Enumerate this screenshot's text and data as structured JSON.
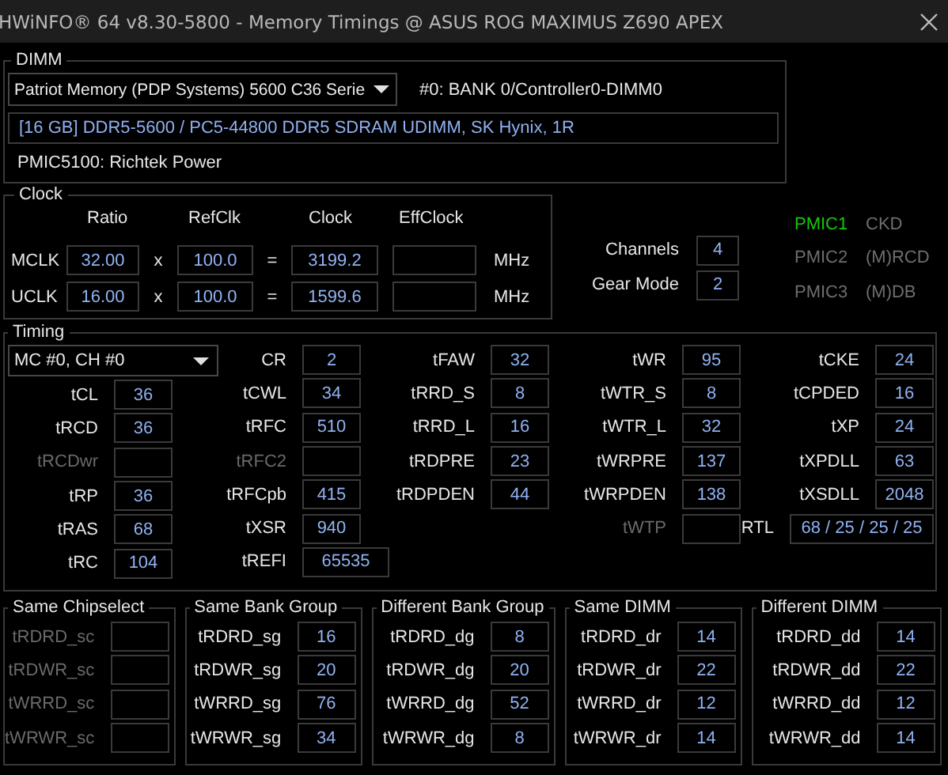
{
  "window": {
    "title": "HWiNFO® 64 v8.30-5800 - Memory Timings @ ASUS ROG MAXIMUS Z690 APEX"
  },
  "dimm": {
    "title": "DIMM",
    "module": {
      "value": "Patriot Memory (PDP Systems) 5600 C36 Serie"
    },
    "slot": "#0: BANK 0/Controller0-DIMM0",
    "description": "[16 GB] DDR5-5600 / PC5-44800 DDR5 SDRAM UDIMM, SK Hynix, 1R",
    "pmic": "PMIC5100: Richtek Power"
  },
  "clock": {
    "title": "Clock",
    "columns": [
      "Ratio",
      "RefClk",
      "Clock",
      "EffClock"
    ],
    "rows": [
      {
        "label": "MCLK",
        "ratio": "32.00",
        "times": "x",
        "refclk": "100.0",
        "equals": "=",
        "clock": "3199.2",
        "unit": "MHz"
      },
      {
        "label": "UCLK",
        "ratio": "16.00",
        "times": "x",
        "refclk": "100.0",
        "equals": "=",
        "clock": "1599.6",
        "unit": "MHz"
      }
    ]
  },
  "memory": [
    {
      "label": "Channels",
      "value": "4"
    },
    {
      "label": "Gear Mode",
      "value": "2"
    }
  ],
  "pmic_status": [
    {
      "label": "PMIC1",
      "detail": "CKD",
      "active": true
    },
    {
      "label": "PMIC2",
      "detail": "(M)RCD",
      "active": false
    },
    {
      "label": "PMIC3",
      "detail": "(M)DB",
      "active": false
    }
  ],
  "timing": {
    "title": "Timing",
    "selector": {
      "value": "MC #0, CH #0"
    },
    "columns": [
      [
        {
          "label": "tCL",
          "value": "36",
          "disabled": false,
          "kind": "field"
        },
        {
          "label": "tRCD",
          "value": "36",
          "disabled": false,
          "kind": "field"
        },
        {
          "label": "tRCDwr",
          "disabled": true,
          "kind": "field"
        },
        {
          "label": "tRP",
          "value": "36",
          "disabled": false,
          "kind": "field"
        },
        {
          "label": "tRAS",
          "value": "68",
          "disabled": false,
          "kind": "field"
        },
        {
          "label": "tRC",
          "value": "104",
          "disabled": false,
          "kind": "field"
        }
      ],
      [
        {
          "label": "CR",
          "value": "2",
          "disabled": false,
          "kind": "field"
        },
        {
          "label": "tCWL",
          "value": "34",
          "disabled": false,
          "kind": "field"
        },
        {
          "label": "tRFC",
          "value": "510",
          "disabled": false,
          "kind": "field"
        },
        {
          "label": "tRFC2",
          "disabled": true,
          "kind": "field"
        },
        {
          "label": "tRFCpb",
          "value": "415",
          "disabled": false,
          "kind": "field"
        },
        {
          "label": "tXSR",
          "value": "940",
          "disabled": false,
          "kind": "field"
        },
        {
          "label": "tREFI",
          "value": "65535",
          "disabled": false,
          "kind": "wide"
        }
      ],
      [
        {
          "label": "tFAW",
          "value": "32",
          "disabled": false,
          "kind": "field"
        },
        {
          "label": "tRRD_S",
          "value": "8",
          "disabled": false,
          "kind": "field"
        },
        {
          "label": "tRRD_L",
          "value": "16",
          "disabled": false,
          "kind": "field"
        },
        {
          "label": "tRDPRE",
          "value": "23",
          "disabled": false,
          "kind": "field"
        },
        {
          "label": "tRDPDEN",
          "value": "44",
          "disabled": false,
          "kind": "field"
        }
      ],
      [
        {
          "label": "tWR",
          "value": "95",
          "disabled": false,
          "kind": "field"
        },
        {
          "label": "tWTR_S",
          "value": "8",
          "disabled": false,
          "kind": "field"
        },
        {
          "label": "tWTR_L",
          "value": "32",
          "disabled": false,
          "kind": "field"
        },
        {
          "label": "tWRPRE",
          "value": "137",
          "disabled": false,
          "kind": "field"
        },
        {
          "label": "tWRPDEN",
          "value": "138",
          "disabled": false,
          "kind": "field"
        },
        {
          "label": "tWTP",
          "disabled": true,
          "kind": "field"
        }
      ],
      [
        {
          "label": "tCKE",
          "value": "24",
          "disabled": false,
          "kind": "field"
        },
        {
          "label": "tCPDED",
          "value": "16",
          "disabled": false,
          "kind": "field"
        },
        {
          "label": "tXP",
          "value": "24",
          "disabled": false,
          "kind": "field"
        },
        {
          "label": "tXPDLL",
          "value": "63",
          "disabled": false,
          "kind": "field"
        },
        {
          "label": "tXSDLL",
          "value": "2048",
          "disabled": false,
          "kind": "field"
        },
        {
          "label": "RTL",
          "value": "68 / 25 / 25 / 25",
          "disabled": false,
          "kind": "wide"
        }
      ]
    ]
  },
  "groups": [
    {
      "title": "Same Chipselect",
      "items": [
        {
          "label": "tRDRD_sc",
          "disabled": true
        },
        {
          "label": "tRDWR_sc",
          "disabled": true
        },
        {
          "label": "tWRRD_sc",
          "disabled": true
        },
        {
          "label": "tWRWR_sc",
          "disabled": true
        }
      ]
    },
    {
      "title": "Same Bank Group",
      "items": [
        {
          "label": "tRDRD_sg",
          "value": "16",
          "disabled": false
        },
        {
          "label": "tRDWR_sg",
          "value": "20",
          "disabled": false
        },
        {
          "label": "tWRRD_sg",
          "value": "76",
          "disabled": false
        },
        {
          "label": "tWRWR_sg",
          "value": "34",
          "disabled": false
        }
      ]
    },
    {
      "title": "Different Bank Group",
      "items": [
        {
          "label": "tRDRD_dg",
          "value": "8",
          "disabled": false
        },
        {
          "label": "tRDWR_dg",
          "value": "20",
          "disabled": false
        },
        {
          "label": "tWRRD_dg",
          "value": "52",
          "disabled": false
        },
        {
          "label": "tWRWR_dg",
          "value": "8",
          "disabled": false
        }
      ]
    },
    {
      "title": "Same DIMM",
      "items": [
        {
          "label": "tRDRD_dr",
          "value": "14",
          "disabled": false
        },
        {
          "label": "tRDWR_dr",
          "value": "22",
          "disabled": false
        },
        {
          "label": "tWRRD_dr",
          "value": "12",
          "disabled": false
        },
        {
          "label": "tWRWR_dr",
          "value": "14",
          "disabled": false
        }
      ]
    },
    {
      "title": "Different DIMM",
      "items": [
        {
          "label": "tRDRD_dd",
          "value": "14",
          "disabled": false
        },
        {
          "label": "tRDWR_dd",
          "value": "22",
          "disabled": false
        },
        {
          "label": "tWRRD_dd",
          "value": "12",
          "disabled": false
        },
        {
          "label": "tWRWR_dd",
          "value": "14",
          "disabled": false
        }
      ]
    }
  ]
}
